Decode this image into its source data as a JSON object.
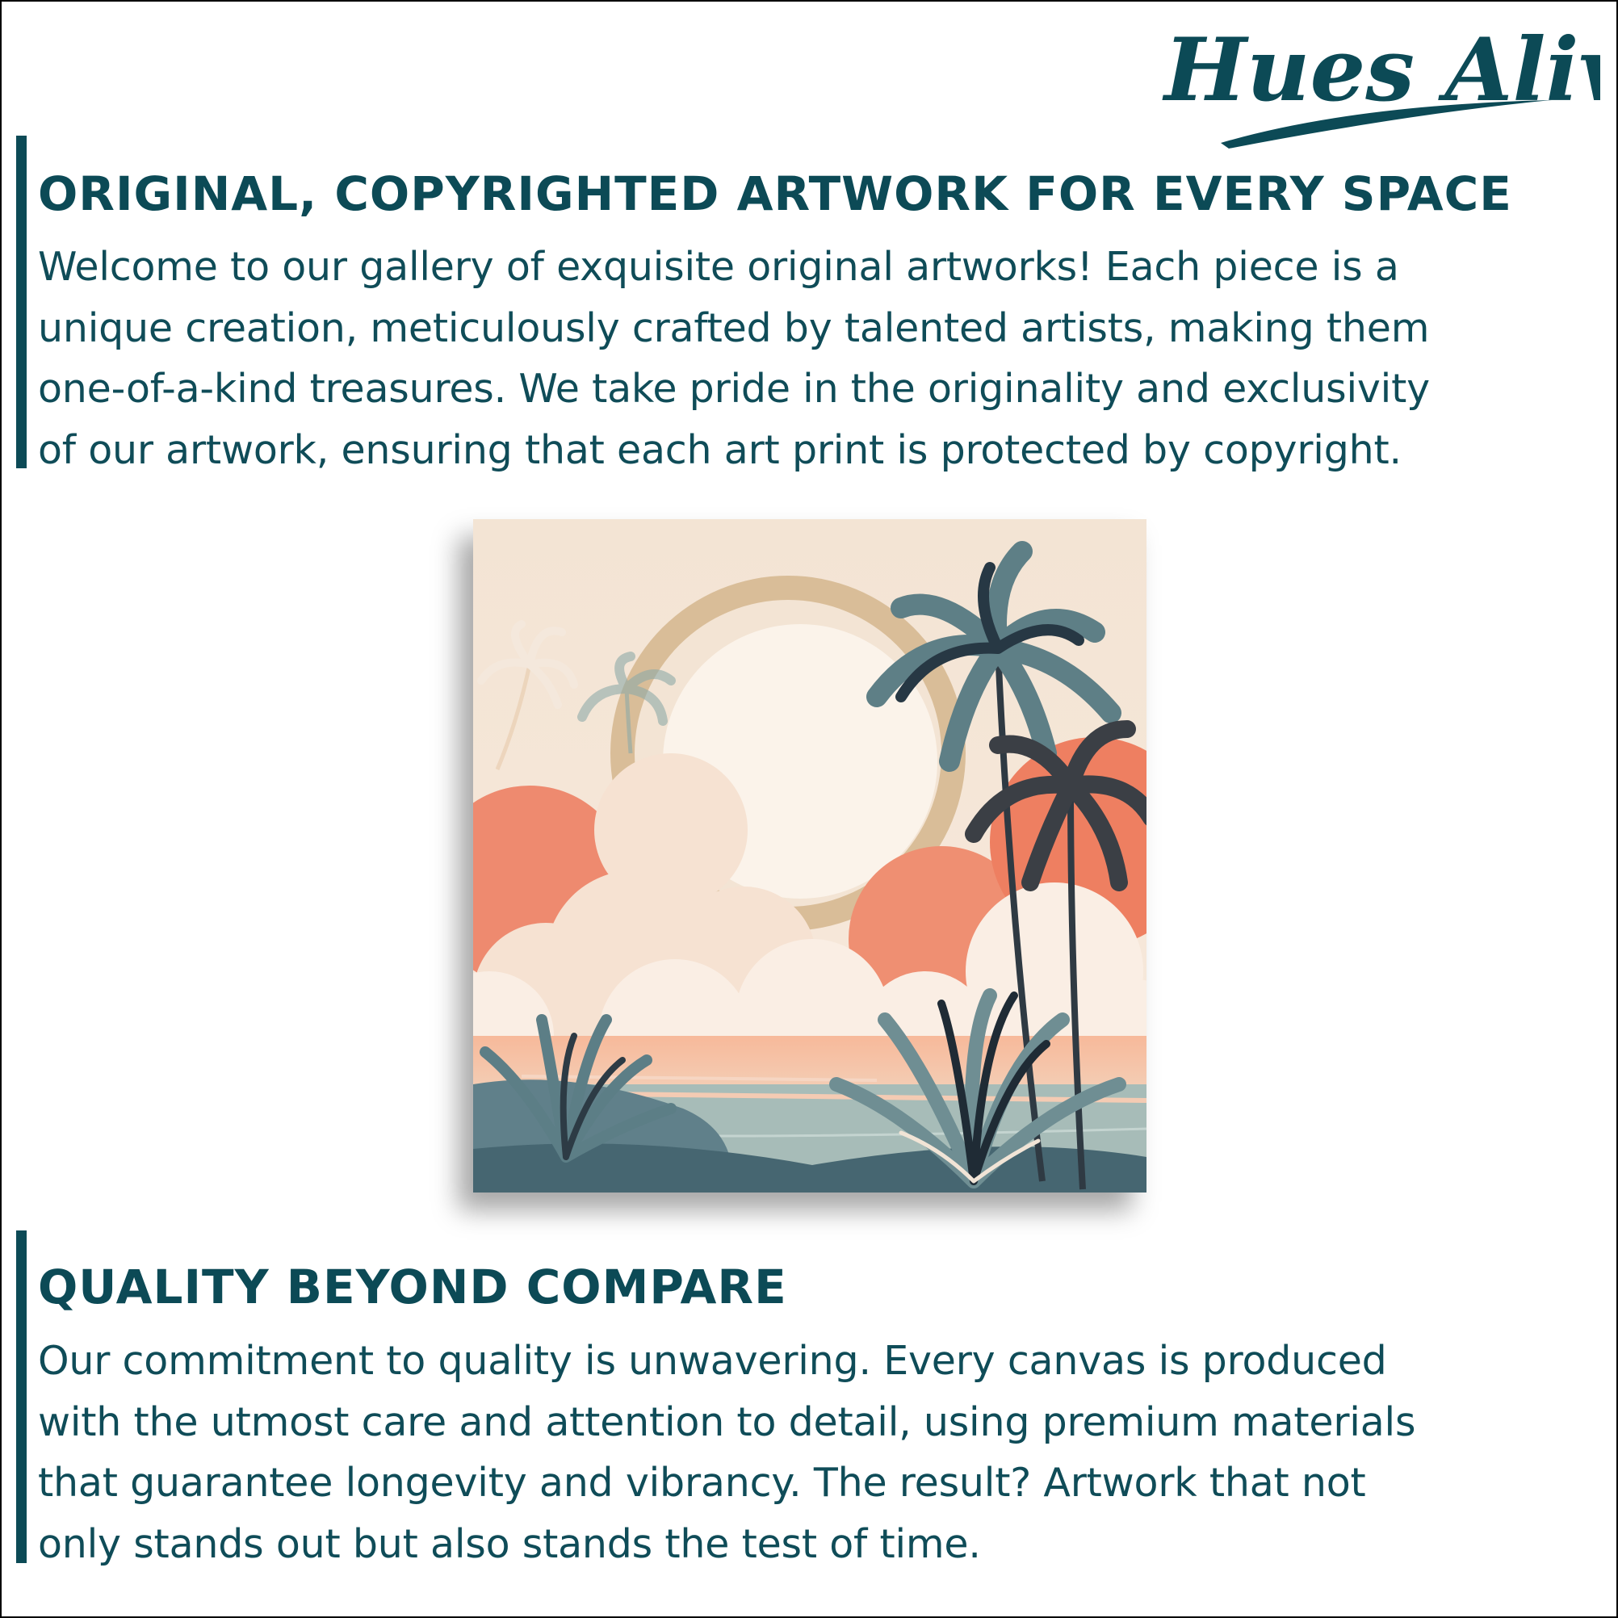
{
  "brand": {
    "name": "Hues Alive"
  },
  "colors": {
    "accent": "#0c4a56",
    "text": "#0f4c58",
    "frame": "#000000"
  },
  "section1": {
    "heading": "ORIGINAL, COPYRIGHTED ARTWORK FOR EVERY SPACE",
    "lines": [
      "Welcome to our gallery of exquisite original artworks! Each piece is a",
      "unique creation, meticulously crafted by talented artists, making them",
      "one-of-a-kind treasures. We take pride in the originality and exclusivity",
      "of our artwork, ensuring that each art print is protected by copyright."
    ]
  },
  "artwork": {
    "subject": "tropical palm trees sunset illustration"
  },
  "section2": {
    "heading": "QUALITY BEYOND COMPARE",
    "lines": [
      "Our commitment to quality is unwavering. Every canvas is produced",
      "with the utmost care and attention to detail, using premium materials",
      "that guarantee longevity and vibrancy. The result? Artwork that not",
      "only stands out but also stands the test of time."
    ]
  }
}
